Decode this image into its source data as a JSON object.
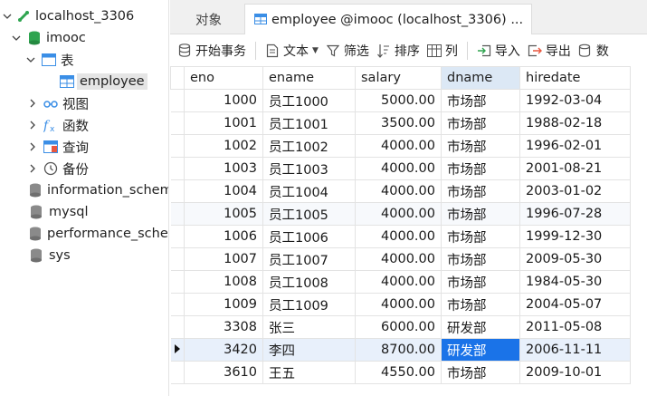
{
  "sidebar": {
    "connection": {
      "label": "localhost_3306",
      "icon": "connection-icon"
    },
    "database": {
      "label": "imooc",
      "icon": "database-icon"
    },
    "tables_group": {
      "label": "表",
      "icon": "table-folder-icon"
    },
    "selected_table": {
      "label": "employee",
      "icon": "table-icon"
    },
    "groups": [
      {
        "label": "视图",
        "icon": "view-icon"
      },
      {
        "label": "函数",
        "icon": "function-icon"
      },
      {
        "label": "查询",
        "icon": "query-icon"
      },
      {
        "label": "备份",
        "icon": "backup-icon"
      }
    ],
    "other_databases": [
      {
        "label": "information_schema"
      },
      {
        "label": "mysql"
      },
      {
        "label": "performance_schema"
      },
      {
        "label": "sys"
      }
    ]
  },
  "tabs": [
    {
      "label": "对象"
    },
    {
      "label": "employee @imooc (localhost_3306) ..."
    }
  ],
  "toolbar": {
    "begin_transaction": "开始事务",
    "text": "文本",
    "filter": "筛选",
    "sort": "排序",
    "columns": "列",
    "import": "导入",
    "export": "导出",
    "data": "数"
  },
  "grid": {
    "columns": [
      "eno",
      "ename",
      "salary",
      "dname",
      "hiredate"
    ],
    "active_column": "dname",
    "current_row_index": 11,
    "rows": [
      [
        "1000",
        "员工1000",
        "5000.00",
        "市场部",
        "1992-03-04"
      ],
      [
        "1001",
        "员工1001",
        "3500.00",
        "市场部",
        "1988-02-18"
      ],
      [
        "1002",
        "员工1002",
        "4000.00",
        "市场部",
        "1996-02-01"
      ],
      [
        "1003",
        "员工1003",
        "4000.00",
        "市场部",
        "2001-08-21"
      ],
      [
        "1004",
        "员工1004",
        "4000.00",
        "市场部",
        "2003-01-02"
      ],
      [
        "1005",
        "员工1005",
        "4000.00",
        "市场部",
        "1996-07-28"
      ],
      [
        "1006",
        "员工1006",
        "4000.00",
        "市场部",
        "1999-12-30"
      ],
      [
        "1007",
        "员工1007",
        "4000.00",
        "市场部",
        "2009-05-30"
      ],
      [
        "1008",
        "员工1008",
        "4000.00",
        "市场部",
        "1984-05-30"
      ],
      [
        "1009",
        "员工1009",
        "4000.00",
        "市场部",
        "2004-05-07"
      ],
      [
        "3308",
        "张三",
        "6000.00",
        "研发部",
        "2011-05-08"
      ],
      [
        "3420",
        "李四",
        "8700.00",
        "研发部",
        "2006-11-11"
      ],
      [
        "3610",
        "王五",
        "4550.00",
        "市场部",
        "2009-10-01"
      ]
    ]
  },
  "colors": {
    "selection": "#1a73e8",
    "current_row": "#e8f0fb",
    "active_header": "#dce8f5",
    "database_green": "#2ea44f",
    "table_blue": "#3a8ee6"
  }
}
